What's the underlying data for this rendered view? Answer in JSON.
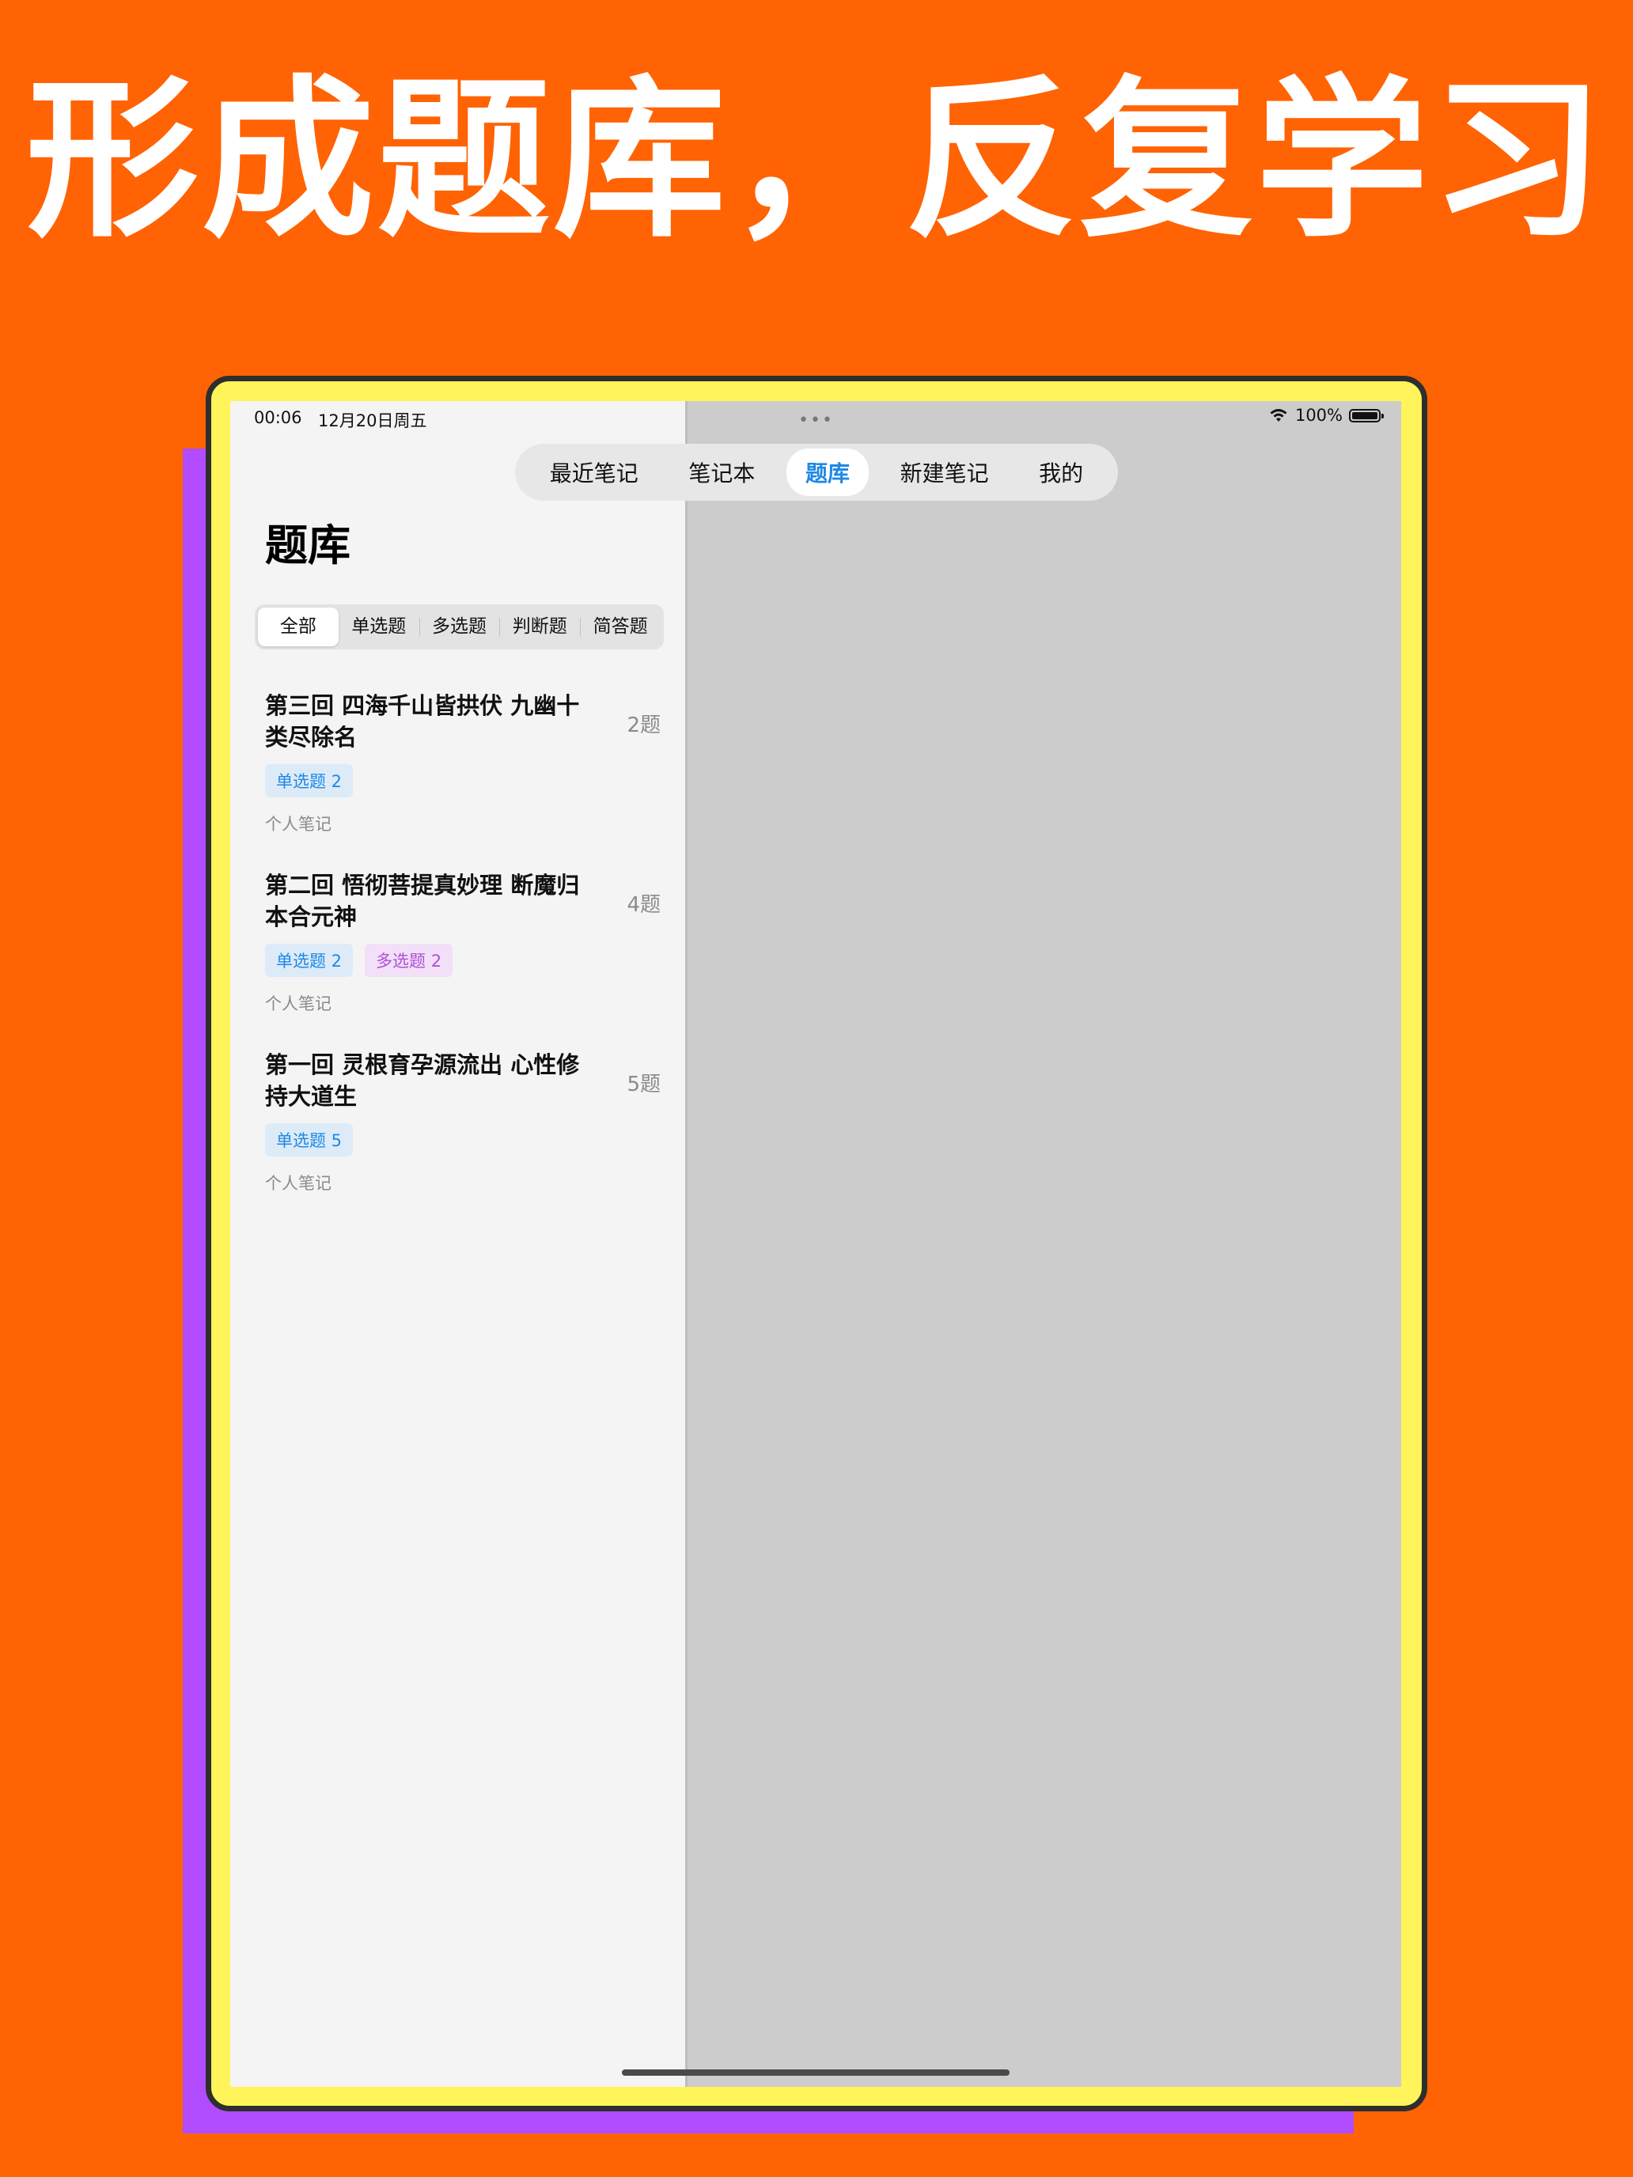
{
  "headline": "形成题库，反复学习",
  "status_bar": {
    "time": "00:06",
    "date": "12月20日周五",
    "multitask": "•••",
    "battery_pct": "100%"
  },
  "tabs": [
    {
      "label": "最近笔记",
      "active": false
    },
    {
      "label": "笔记本",
      "active": false
    },
    {
      "label": "题库",
      "active": true
    },
    {
      "label": "新建笔记",
      "active": false
    },
    {
      "label": "我的",
      "active": false
    }
  ],
  "page_title": "题库",
  "segments": [
    "全部",
    "单选题",
    "多选题",
    "判断题",
    "简答题"
  ],
  "selected_segment": "全部",
  "banks": [
    {
      "title": "第三回 四海千山皆拱伏 九幽十类尽除名",
      "count": "2题",
      "tags": [
        {
          "label": "单选题 2",
          "kind": "single"
        }
      ],
      "source": "个人笔记"
    },
    {
      "title": "第二回 悟彻菩提真妙理 断魔归本合元神",
      "count": "4题",
      "tags": [
        {
          "label": "单选题 2",
          "kind": "single"
        },
        {
          "label": "多选题 2",
          "kind": "multi"
        }
      ],
      "source": "个人笔记"
    },
    {
      "title": "第一回 灵根育孕源流出 心性修持大道生",
      "count": "5题",
      "tags": [
        {
          "label": "单选题 5",
          "kind": "single"
        }
      ],
      "source": "个人笔记"
    }
  ],
  "colors": {
    "background": "#FF6304",
    "device_frame": "#FFF45A",
    "shadow": "#B24CFF",
    "accent": "#1E88E5"
  },
  "icons": [
    "wifi-icon",
    "battery-icon"
  ]
}
